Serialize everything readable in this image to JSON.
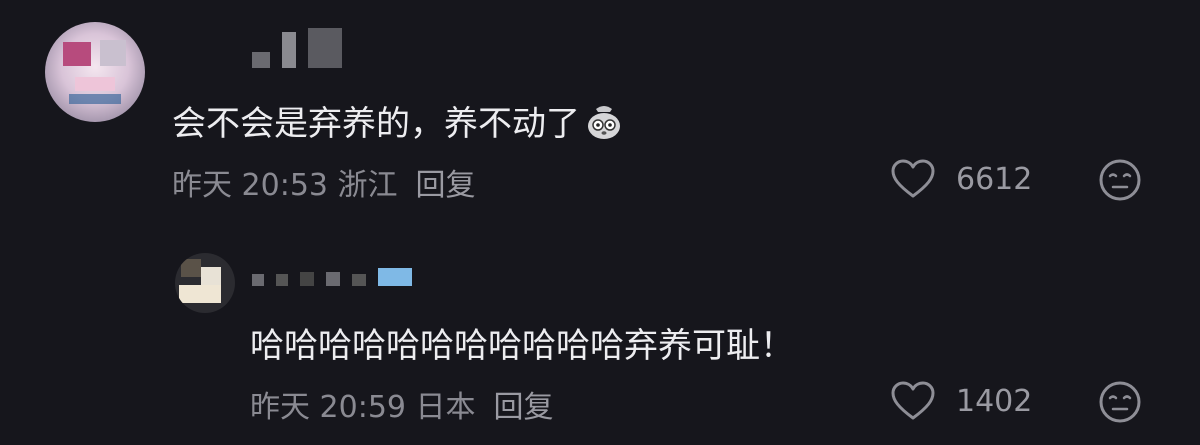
{
  "comment": {
    "text": "会不会是弃养的，养不动了",
    "emoji": "shocked-bag-emoji",
    "time": "昨天 20:53 浙江",
    "reply_label": "回复",
    "likes": "6612"
  },
  "reply": {
    "text": "哈哈哈哈哈哈哈哈哈哈哈弃养可耻！",
    "time": "昨天 20:59 日本",
    "reply_label": "回复",
    "likes": "1402"
  },
  "icons": {
    "like": "heart-outline-icon",
    "react": "face-emoji-icon"
  },
  "colors": {
    "background": "#16161c",
    "text": "#ededf0",
    "meta": "#8a8a92"
  }
}
